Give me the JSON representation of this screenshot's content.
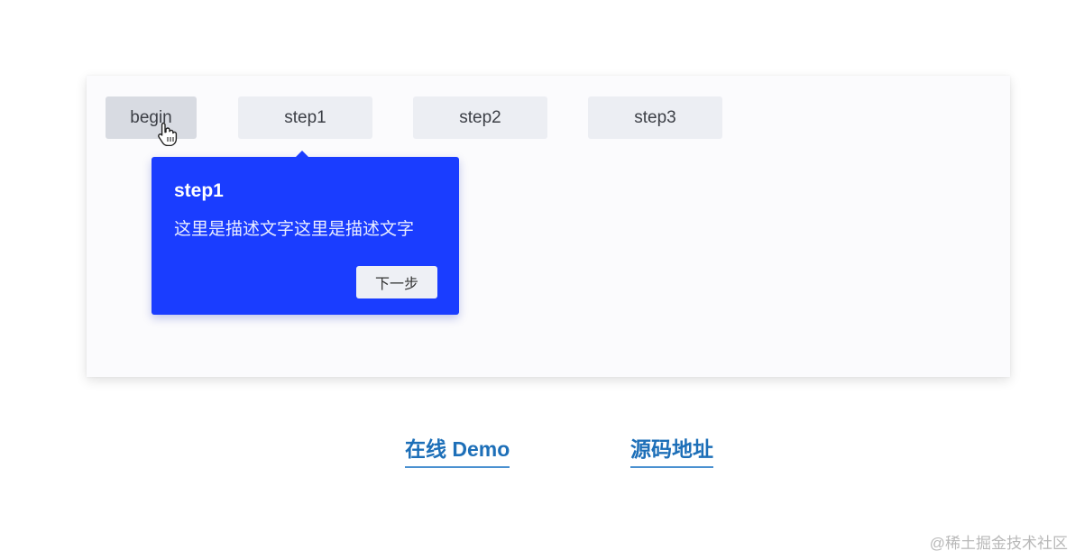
{
  "steps": {
    "begin": "begin",
    "step1": "step1",
    "step2": "step2",
    "step3": "step3"
  },
  "popover": {
    "title": "step1",
    "description": "这里是描述文字这里是描述文字",
    "next_label": "下一步",
    "color": "#1a3dff"
  },
  "links": {
    "demo": "在线 Demo",
    "source": "源码地址"
  },
  "watermark": "@稀土掘金技术社区",
  "icons": {
    "cursor": "hand-pointer-icon"
  }
}
